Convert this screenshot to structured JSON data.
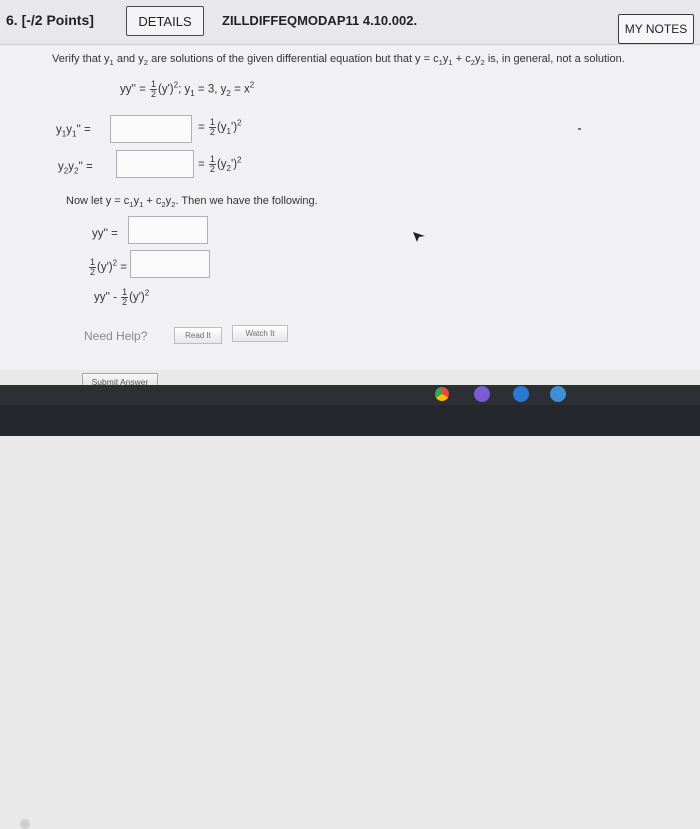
{
  "header": {
    "question_number": "6. [-/2 Points]",
    "details_label": "DETAILS",
    "problem_code": "ZILLDIFFEQMODAP11 4.10.002.",
    "my_notes_label": "MY NOTES"
  },
  "prompt": {
    "before": "Verify that y",
    "and": " and y",
    "mid": " are solutions of the given differential equation but that y = c",
    "y1part": "y",
    "plus": " + c",
    "y2part": "y",
    "after": " is, in general, not a solution."
  },
  "given_equation": {
    "lhs": "yy'' = ",
    "frac_num": "1",
    "frac_den": "2",
    "rest": "(y')",
    "sq": "2",
    "y1": "; y",
    "y1val": " = 3, y",
    "y2val": " = x",
    "x_sq": "2"
  },
  "row1": {
    "label": "y",
    "label2": "y",
    "label_tail": "'' =",
    "rhs_eq": "= ",
    "num": "1",
    "den": "2",
    "rhs": "(y",
    "rhs_tail": "')",
    "sq": "2"
  },
  "row2": {
    "label": "y",
    "label2": "y",
    "label_tail": "'' =",
    "rhs_eq": "= ",
    "num": "1",
    "den": "2",
    "rhs": "(y",
    "rhs_tail": "')",
    "sq": "2"
  },
  "now_text": {
    "before": "Now let y = c",
    "y1": "y",
    "plus": " + c",
    "y2": "y",
    "after": ". Then we have the following."
  },
  "row3": {
    "label": "yy'' ="
  },
  "row4": {
    "num": "1",
    "den": "2",
    "body": "(y')",
    "sq": "2",
    "eq": " ="
  },
  "row5": {
    "lhs": "yy'' - ",
    "num": "1",
    "den": "2",
    "body": "(y')",
    "sq": "2"
  },
  "help": {
    "label": "Need Help?",
    "read_it": "Read It",
    "watch_it": "Watch It"
  },
  "submit_label": "Submit Answer",
  "subscripts": {
    "one": "1",
    "two": "2"
  },
  "colors": {
    "accent_blue": "#3d8fd6",
    "taskbar": "#24282c"
  }
}
